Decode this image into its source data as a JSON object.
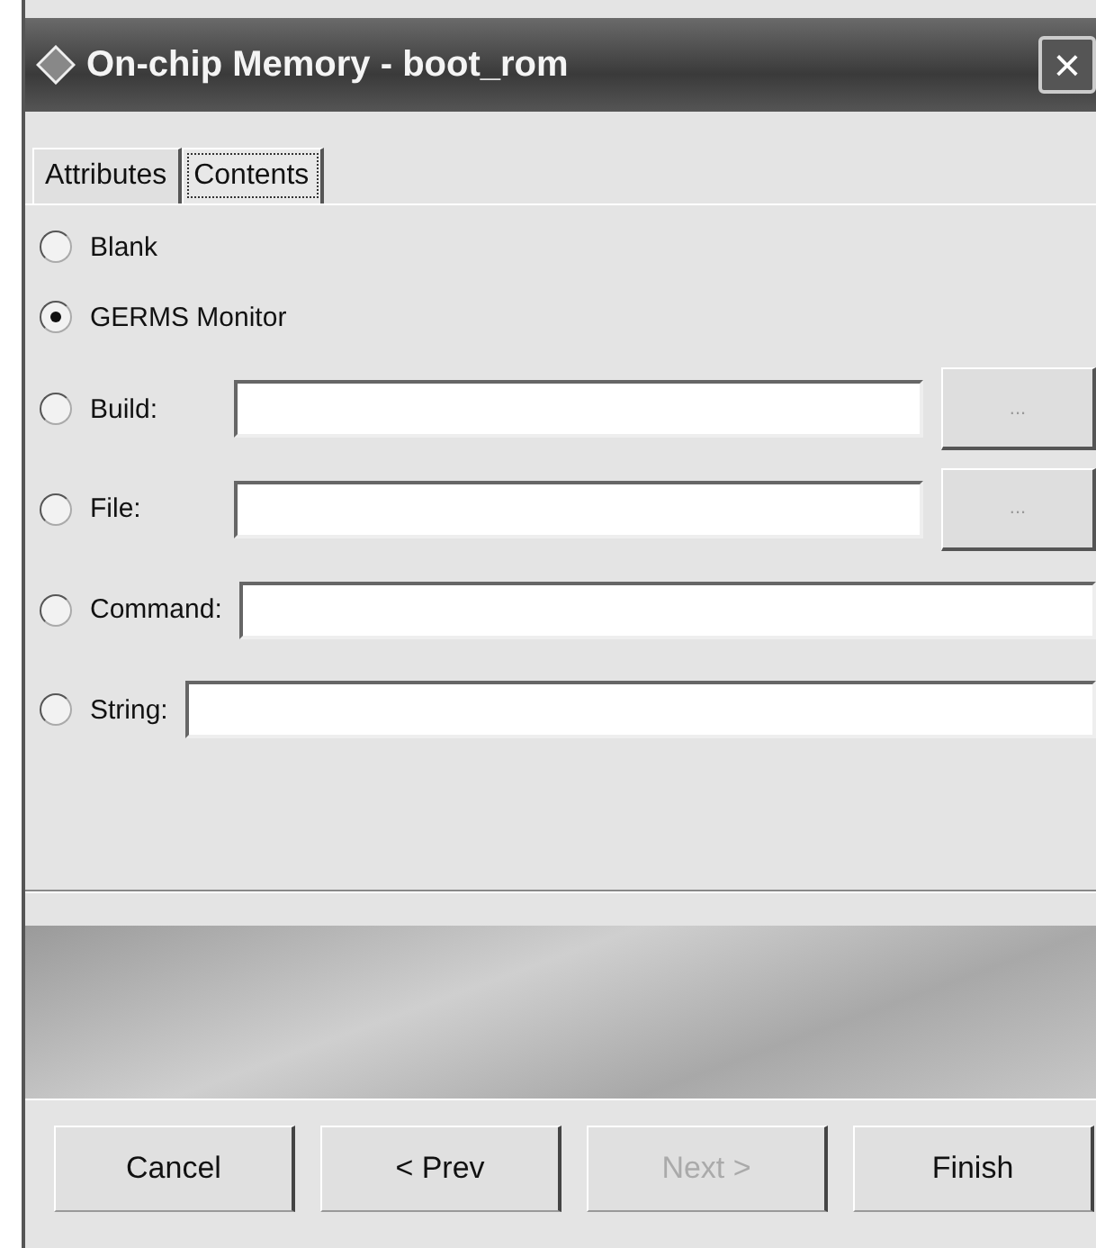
{
  "window": {
    "title": "On-chip Memory - boot_rom",
    "close": "×"
  },
  "tabs": [
    {
      "label": "Attributes",
      "selected": false
    },
    {
      "label": "Contents",
      "selected": true
    }
  ],
  "options": [
    {
      "kind": "plain",
      "label": "Blank",
      "selected": false
    },
    {
      "kind": "plain",
      "label": "GERMS Monitor",
      "selected": true
    },
    {
      "kind": "browse",
      "label": "Build:",
      "selected": false,
      "browse": "..."
    },
    {
      "kind": "browse",
      "label": "File:",
      "selected": false,
      "browse": "..."
    },
    {
      "kind": "field",
      "label": "Command:",
      "selected": false
    },
    {
      "kind": "field",
      "label": "String:",
      "selected": false
    }
  ],
  "buttons": [
    {
      "label": "Cancel",
      "disabled": false
    },
    {
      "label": "< Prev",
      "disabled": false
    },
    {
      "label": "Next >",
      "disabled": true
    },
    {
      "label": "Finish",
      "disabled": false
    }
  ]
}
